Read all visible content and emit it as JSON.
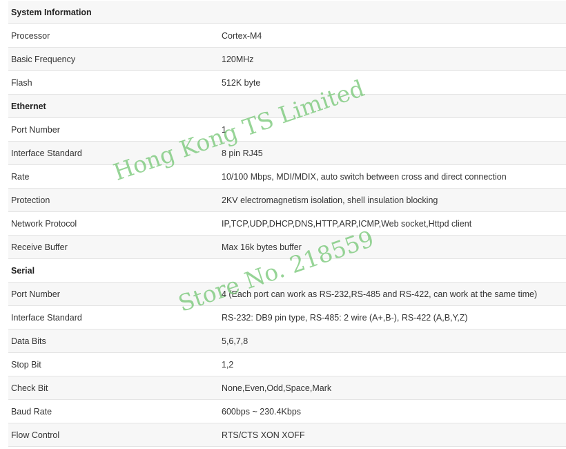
{
  "watermark": {
    "line1": "Hong Kong TS Limited",
    "line2": "Store No. 218559",
    "color": "#7ac87a"
  },
  "sections": [
    {
      "title": "System Information",
      "rows": [
        {
          "label": "Processor",
          "value": "Cortex-M4"
        },
        {
          "label": "Basic Frequency",
          "value": "120MHz"
        },
        {
          "label": "Flash",
          "value": "512K byte"
        }
      ]
    },
    {
      "title": "Ethernet",
      "rows": [
        {
          "label": "Port Number",
          "value": "1"
        },
        {
          "label": "Interface Standard",
          "value": "8 pin RJ45"
        },
        {
          "label": "Rate",
          "value": "10/100 Mbps, MDI/MDIX, auto switch between cross and direct connection"
        },
        {
          "label": "Protection",
          "value": "2KV electromagnetism isolation, shell insulation blocking"
        },
        {
          "label": "Network Protocol",
          "value": "IP,TCP,UDP,DHCP,DNS,HTTP,ARP,ICMP,Web socket,Httpd client"
        },
        {
          "label": "Receive Buffer",
          "value": "Max 16k bytes buffer"
        }
      ]
    },
    {
      "title": "Serial",
      "rows": [
        {
          "label": "Port Number",
          "value": "4 (Each port can work as RS-232,RS-485 and RS-422, can work at the same time)"
        },
        {
          "label": "Interface Standard",
          "value": "RS-232: DB9 pin type, RS-485: 2 wire (A+,B-), RS-422 (A,B,Y,Z)"
        },
        {
          "label": "Data Bits",
          "value": "5,6,7,8"
        },
        {
          "label": "Stop Bit",
          "value": "1,2"
        },
        {
          "label": "Check Bit",
          "value": "None,Even,Odd,Space,Mark"
        },
        {
          "label": "Baud Rate",
          "value": "600bps ~ 230.4Kbps"
        },
        {
          "label": "Flow Control",
          "value": "RTS/CTS XON XOFF"
        }
      ]
    }
  ]
}
